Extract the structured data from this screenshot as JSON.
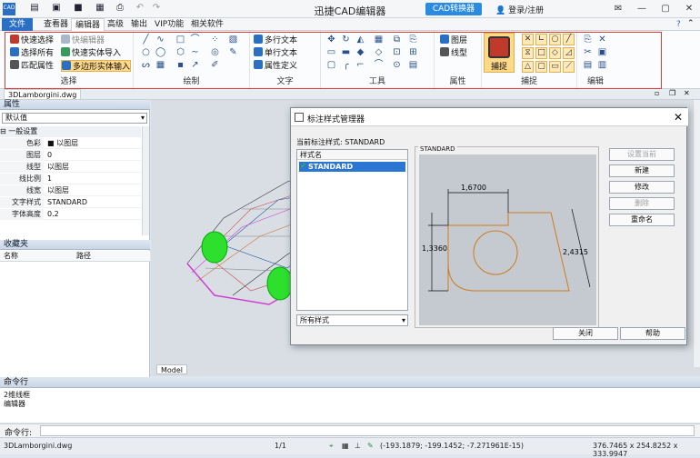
{
  "titlebar": {
    "app_title": "迅捷CAD编辑器",
    "convert_button": "CAD转换器",
    "login": "登录/注册",
    "app_icon": "CAD"
  },
  "menu": {
    "file": "文件",
    "items": [
      "查看器",
      "编辑器",
      "高级",
      "输出",
      "VIP功能",
      "相关软件"
    ]
  },
  "ribbon": {
    "select": {
      "label": "选择",
      "quick_select": "快速选择",
      "select_all": "选择所有",
      "match_props": "匹配属性",
      "quick_editor": "快编辑器",
      "quick_entity_import": "快速实体导入",
      "polygon_entity_input": "多边形实体输入"
    },
    "draw": {
      "label": "绘制"
    },
    "text": {
      "label": "文字",
      "mtext": "多行文本",
      "stext": "单行文本",
      "attdef": "属性定义"
    },
    "tools": {
      "label": "工具"
    },
    "props": {
      "label": "属性",
      "layer": "图层",
      "linetype": "线型"
    },
    "snap": {
      "label": "捕捉",
      "snap_button": "捕捉"
    },
    "edit": {
      "label": "编辑"
    }
  },
  "doc_tab": "3DLamborgini.dwg",
  "left_panel": {
    "props_title": "属性",
    "default_value": "默认值",
    "general": "一般设置",
    "rows": [
      {
        "k": "色彩",
        "v": "■ 以图层"
      },
      {
        "k": "图层",
        "v": "0"
      },
      {
        "k": "线型",
        "v": "以图层"
      },
      {
        "k": "线比例",
        "v": "1"
      },
      {
        "k": "线宽",
        "v": "以图层"
      },
      {
        "k": "文字样式",
        "v": "STANDARD"
      },
      {
        "k": "字体高度",
        "v": "0.2"
      }
    ],
    "favorites_title": "收藏夹",
    "fav_col_name": "名称",
    "fav_col_path": "路径"
  },
  "model_tab": "Model",
  "dialog": {
    "title": "标注样式管理器",
    "current_label": "当前标注样式:",
    "current_value": "STANDARD",
    "list_header": "样式名",
    "list_item": "STANDARD",
    "filter": "所有样式",
    "preview_label": "STANDARD",
    "dims": {
      "top": "1,6700",
      "left": "1,3360",
      "right": "2,4315"
    },
    "buttons": [
      "设置当前",
      "新建",
      "修改",
      "删除",
      "重命名"
    ],
    "close": "关闭",
    "help": "帮助"
  },
  "command": {
    "title": "命令行",
    "history": [
      "2维线框",
      "编辑器"
    ],
    "input_label": "命令行:"
  },
  "status": {
    "file": "3DLamborgini.dwg",
    "page": "1/1",
    "coords": "(-193.1879; -199.1452; -7.271961E-15)",
    "size": "376.7465 x 254.8252 x 333.9947"
  }
}
